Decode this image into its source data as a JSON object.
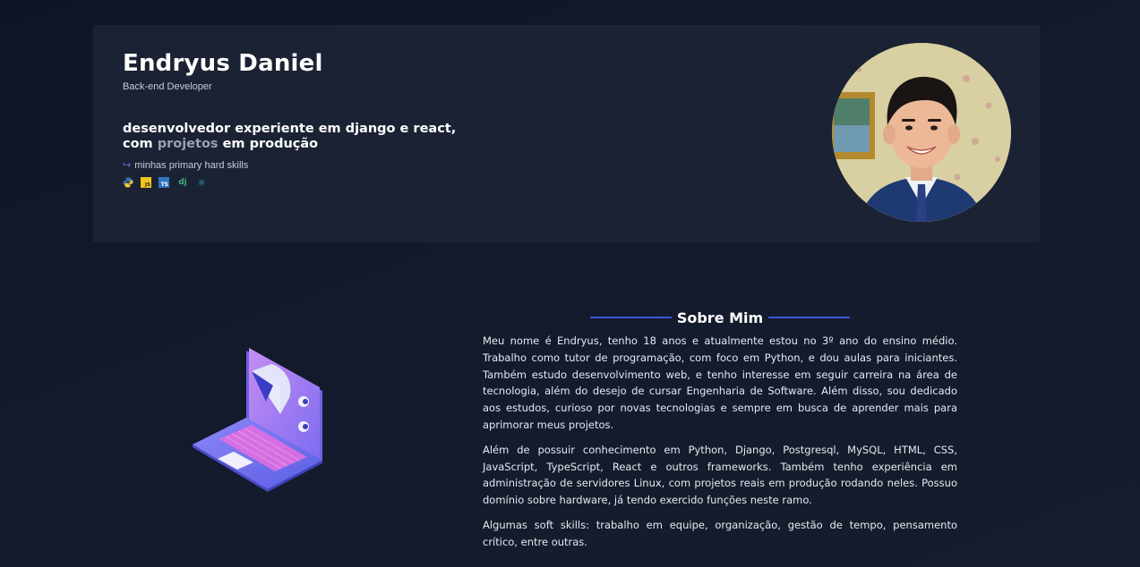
{
  "hero": {
    "name": "Endryus Daniel",
    "role": "Back-end Developer",
    "tagline_part1": "desenvolvedor experiente em django e react, com ",
    "tagline_highlight": "projetos",
    "tagline_part2": " em produção",
    "skills_label": "minhas primary hard skills",
    "skills_icons": [
      "python-icon",
      "javascript-icon",
      "typescript-icon",
      "django-icon",
      "react-icon"
    ],
    "js_badge": "JS",
    "ts_badge": "TS",
    "dj_badge": "dj",
    "react_badge": "⚛"
  },
  "about": {
    "title": "Sobre Mim",
    "paragraphs": [
      "Meu nome é Endryus, tenho 18 anos e atualmente estou no 3º ano do ensino médio. Trabalho como tutor de programação, com foco em Python, e dou aulas para iniciantes. Também estudo desenvolvimento web, e tenho interesse em seguir carreira na área de tecnologia, além do desejo de cursar Engenharia de Software. Além disso, sou dedicado aos estudos, curioso por novas tecnologias e sempre em busca de aprender mais para aprimorar meus projetos.",
      "Além de possuir conhecimento em Python, Django, Postgresql, MySQL, HTML, CSS, JavaScript, TypeScript, React e outros frameworks. Também tenho experiência em administração de servidores Linux, com projetos reais em produção rodando neles. Possuo domínio sobre hardware, já tendo exercido funções neste ramo.",
      "Algumas soft skills: trabalho em equipe, organização, gestão de tempo, pensamento crítico, entre outras."
    ]
  },
  "colors": {
    "background": "#131a2b",
    "card": "#1b2233",
    "accent": "#3b58d8",
    "muted_text": "#9aa2b2"
  }
}
